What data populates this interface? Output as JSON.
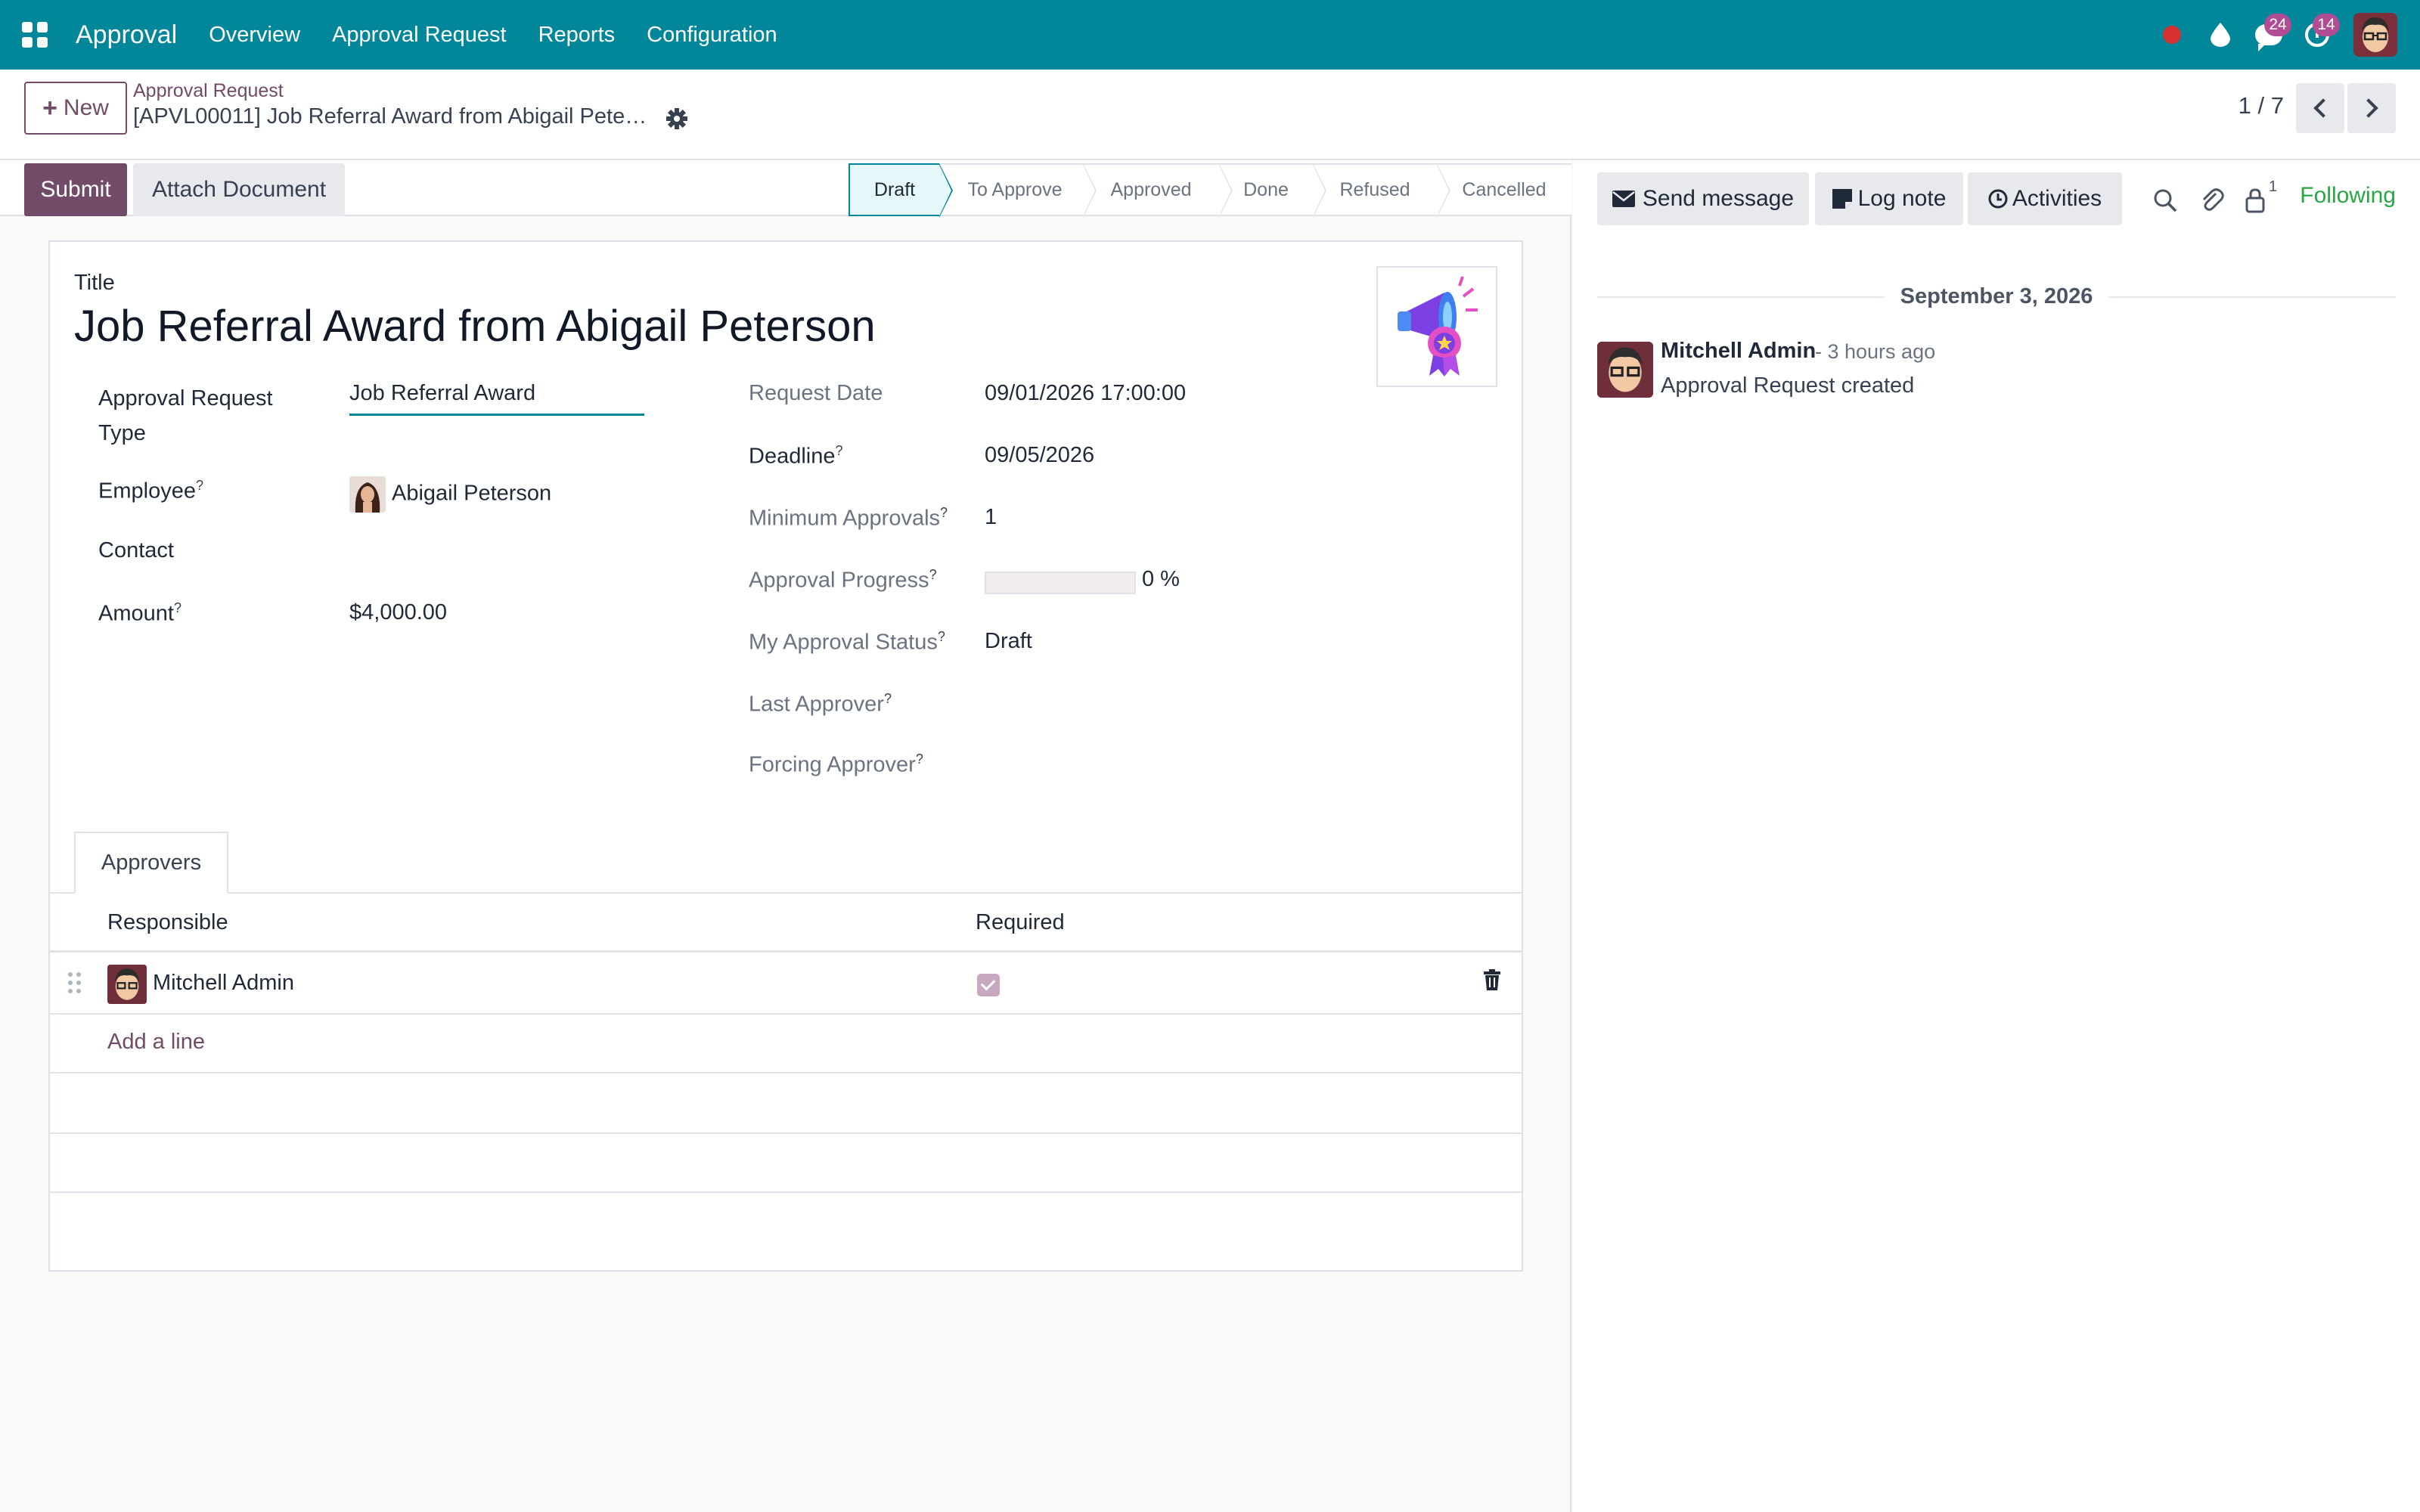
{
  "navbar": {
    "app_name": "Approval",
    "menu": [
      "Overview",
      "Approval Request",
      "Reports",
      "Configuration"
    ],
    "messages_count": "24",
    "activities_count": "14",
    "accent_color": "#01869a"
  },
  "control_panel": {
    "new_label": "New",
    "breadcrumb_parent": "Approval Request",
    "breadcrumb_current": "[APVL00011] Job Referral Award from Abigail Pete…",
    "pager": "1 / 7"
  },
  "statusbar": {
    "submit_label": "Submit",
    "attach_label": "Attach Document",
    "stages": [
      "Draft",
      "To Approve",
      "Approved",
      "Done",
      "Refused",
      "Cancelled"
    ],
    "active_stage": "Draft"
  },
  "form": {
    "title_label": "Title",
    "title_value": "Job Referral Award from Abigail Peterson",
    "left_fields": {
      "type_label_line1": "Approval Request",
      "type_label_line2": "Type",
      "type_value": "Job Referral Award",
      "employee_label": "Employee",
      "employee_value": "Abigail Peterson",
      "contact_label": "Contact",
      "amount_label": "Amount",
      "amount_value": "$4,000.00"
    },
    "right_fields": {
      "request_date_label": "Request Date",
      "request_date_value": "09/01/2026 17:00:00",
      "deadline_label": "Deadline",
      "deadline_value": "09/05/2026",
      "min_approvals_label": "Minimum Approvals",
      "min_approvals_value": "1",
      "progress_label": "Approval Progress",
      "progress_value": "0 %",
      "progress_fraction": 0,
      "my_status_label": "My Approval Status",
      "my_status_value": "Draft",
      "last_approver_label": "Last Approver",
      "forcing_approver_label": "Forcing Approver"
    },
    "help_mark": "?",
    "tab_label": "Approvers",
    "table": {
      "headers": [
        "Responsible",
        "Required"
      ],
      "rows": [
        {
          "responsible": "Mitchell Admin",
          "required": true
        }
      ],
      "add_line": "Add a line"
    }
  },
  "chatter": {
    "send_message": "Send message",
    "log_note": "Log note",
    "activities": "Activities",
    "followers_count": "1",
    "following": "Following",
    "date_separator": "September 3, 2026",
    "messages": [
      {
        "author": "Mitchell Admin",
        "time": "- 3 hours ago",
        "body": "Approval Request created"
      }
    ]
  }
}
